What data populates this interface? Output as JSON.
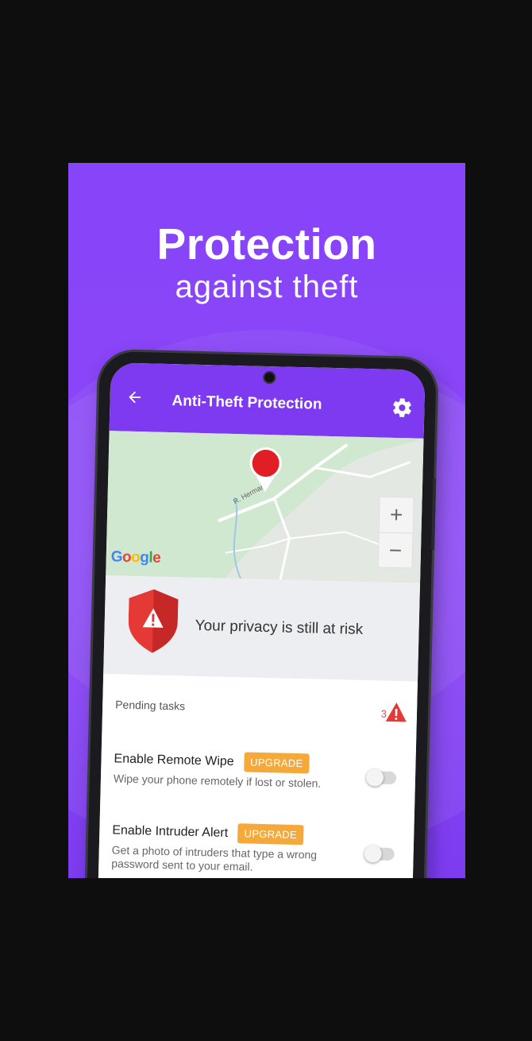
{
  "banner": {
    "headline": "Protection",
    "subheadline": "against theft",
    "background_color": "#8844f8"
  },
  "app": {
    "title": "Anti-Theft Protection",
    "accent_color": "#7d3af0",
    "back_icon": "arrow-left-icon",
    "settings_icon": "gear-icon"
  },
  "map": {
    "street_label": "R. Herman",
    "zoom_in": "+",
    "zoom_out": "−",
    "attribution": "Google"
  },
  "risk": {
    "message": "Your privacy is still at risk",
    "icon": "warning-shield-icon",
    "color": "#e53935"
  },
  "tasks": {
    "header": "Pending tasks",
    "count": "3",
    "items": [
      {
        "title": "Enable Remote Wipe",
        "badge": "UPGRADE",
        "description": "Wipe your phone remotely if lost or stolen.",
        "enabled": false
      },
      {
        "title": "Enable Intruder Alert",
        "badge": "UPGRADE",
        "description": "Get a photo of intruders that type a wrong password sent to your email.",
        "enabled": false
      }
    ]
  }
}
